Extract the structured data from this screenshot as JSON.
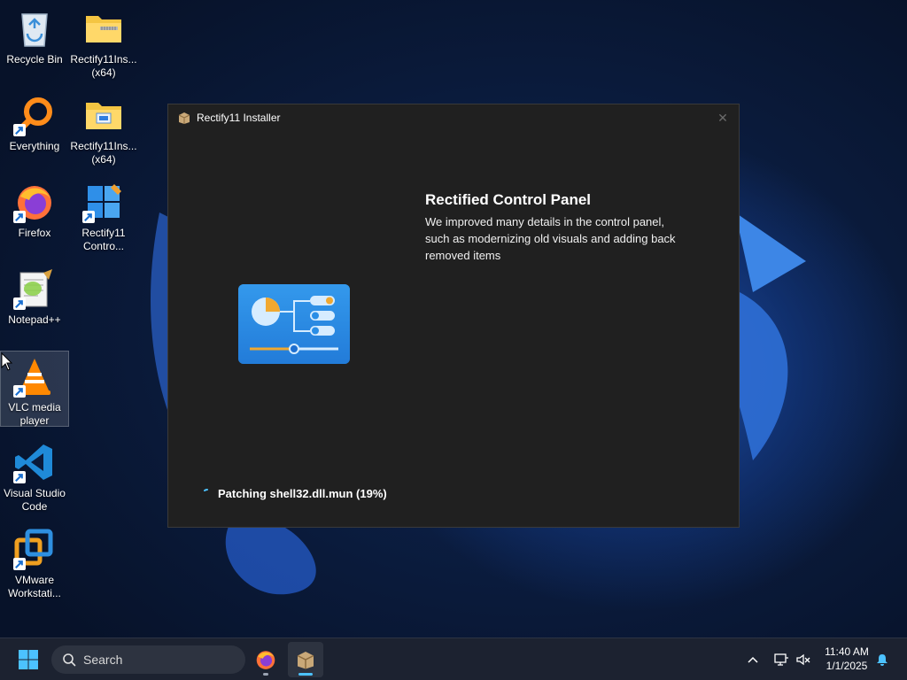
{
  "desktop": {
    "icons": [
      {
        "label": "Recycle Bin",
        "icon": "recycle-bin-icon",
        "shortcut": false
      },
      {
        "label": "Rectify11Ins...\n(x64)",
        "icon": "zip-folder-icon",
        "shortcut": false
      },
      {
        "label": "Everything",
        "icon": "everything-search-icon",
        "shortcut": true
      },
      {
        "label": "Rectify11Ins...\n(x64)",
        "icon": "folder-icon",
        "shortcut": false
      },
      {
        "label": "Firefox",
        "icon": "firefox-icon",
        "shortcut": true
      },
      {
        "label": "Rectify11\nContro...",
        "icon": "rectify11-control-icon",
        "shortcut": true
      },
      {
        "label": "Notepad++",
        "icon": "notepadpp-icon",
        "shortcut": true
      },
      {
        "label": "VLC media\nplayer",
        "icon": "vlc-icon",
        "shortcut": true
      },
      {
        "label": "Visual Studio\nCode",
        "icon": "vscode-icon",
        "shortcut": true
      },
      {
        "label": "VMware\nWorkstati...",
        "icon": "vmware-icon",
        "shortcut": true
      }
    ]
  },
  "installer": {
    "title": "Rectify11 Installer",
    "close_glyph": "✕",
    "feature_title": "Rectified Control Panel",
    "feature_description": "We improved many details in the control panel, such as modernizing old visuals and adding back removed items",
    "status_text": "Patching shell32.dll.mun (19%)"
  },
  "taskbar": {
    "search_label": "Search",
    "clock_time": "11:40 AM",
    "clock_date": "1/1/2025",
    "apps": [
      "firefox-icon",
      "rectify11-installer-icon"
    ]
  },
  "colors": {
    "accent": "#0078d4",
    "window_bg": "#202020",
    "taskbar_bg": "#1c2230"
  }
}
